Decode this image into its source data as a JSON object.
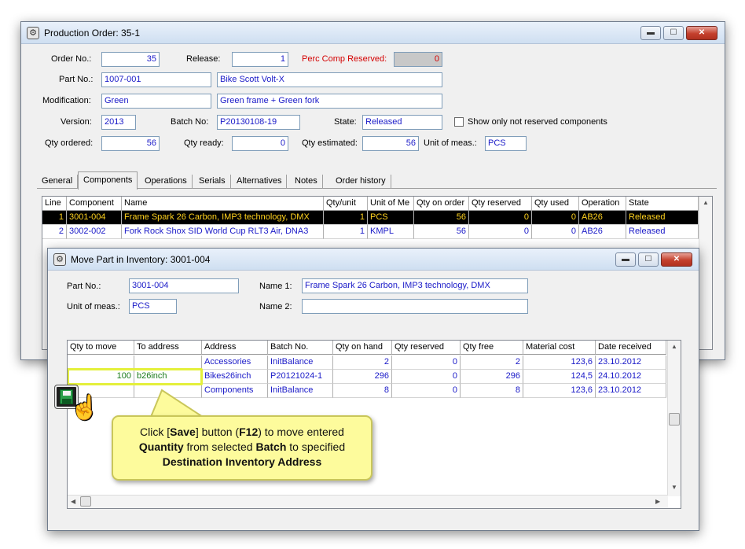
{
  "order_window": {
    "title": "Production Order: 35-1",
    "labels": {
      "order_no": "Order No.:",
      "release": "Release:",
      "perc_comp_reserved": "Perc Comp Reserved:",
      "part_no": "Part No.:",
      "modification": "Modification:",
      "version": "Version:",
      "batch_no": "Batch No:",
      "state": "State:",
      "show_only_not_reserved": "Show only not reserved components",
      "qty_ordered": "Qty ordered:",
      "qty_ready": "Qty ready:",
      "qty_estimated": "Qty estimated:",
      "unit_of_meas": "Unit of meas.:"
    },
    "values": {
      "order_no": "35",
      "release": "1",
      "perc_comp_reserved": "0",
      "part_no": "1007-001",
      "part_name": "Bike Scott Volt-X",
      "modification": "Green",
      "modification_desc": "Green frame + Green fork",
      "version": "2013",
      "batch_no": "P20130108-19",
      "state": "Released",
      "qty_ordered": "56",
      "qty_ready": "0",
      "qty_estimated": "56",
      "unit_of_meas": "PCS"
    },
    "tabs": [
      "General",
      "Components",
      "Operations",
      "Serials",
      "Alternatives",
      "Notes",
      "Order history"
    ],
    "components_grid": {
      "headers": [
        "Line",
        "Component",
        "Name",
        "Qty/unit",
        "Unit of Me",
        "Qty on order",
        "Qty reserved",
        "Qty used",
        "Operation",
        "State"
      ],
      "rows": [
        [
          "1",
          "3001-004",
          "Frame Spark 26 Carbon, IMP3 technology, DMX",
          "1",
          "PCS",
          "56",
          "0",
          "0",
          "AB26",
          "Released"
        ],
        [
          "2",
          "3002-002",
          "Fork Rock Shox SID World Cup RLT3 Air, DNA3",
          "1",
          "KMPL",
          "56",
          "0",
          "0",
          "AB26",
          "Released"
        ]
      ]
    }
  },
  "move_window": {
    "title": "Move Part in Inventory: 3001-004",
    "labels": {
      "part_no": "Part No.:",
      "name1": "Name 1:",
      "unit_of_meas": "Unit of meas.:",
      "name2": "Name 2:"
    },
    "values": {
      "part_no": "3001-004",
      "name1": "Frame Spark 26 Carbon, IMP3 technology, DMX",
      "unit_of_meas": "PCS",
      "name2": ""
    },
    "grid": {
      "headers": [
        "Qty to move",
        "To address",
        "Address",
        "Batch No.",
        "Qty on hand",
        "Qty reserved",
        "Qty free",
        "Material cost",
        "Date received"
      ],
      "rows": [
        [
          "",
          "",
          "Accessories",
          "InitBalance",
          "2",
          "0",
          "2",
          "123,6",
          "23.10.2012"
        ],
        [
          "100",
          "b26inch",
          "Bikes26inch",
          "P20121024-1",
          "296",
          "0",
          "296",
          "124,5",
          "24.10.2012"
        ],
        [
          "",
          "",
          "Components",
          "InitBalance",
          "8",
          "0",
          "8",
          "123,6",
          "23.10.2012"
        ]
      ]
    }
  },
  "callout": {
    "t1": "Click [",
    "save": "Save",
    "t2": "] button (",
    "f12": "F12",
    "t3": ") to move entered",
    "quantity": "Quantity",
    "t4": " from selected ",
    "batch": "Batch",
    "t5": " to specified",
    "dest": "Destination Inventory Address"
  },
  "icons": {
    "window_icon": "gear-icon",
    "save": "floppy-disk-icon",
    "cursor": "hand-pointer-icon"
  },
  "colors": {
    "field_text": "#1a1ac8",
    "perc_label": "#d40000",
    "selected_row_bg": "#000000",
    "selected_row_text": "#ffd21e",
    "callout_bg": "#fdfb9c",
    "highlight": "#e4f03c"
  }
}
